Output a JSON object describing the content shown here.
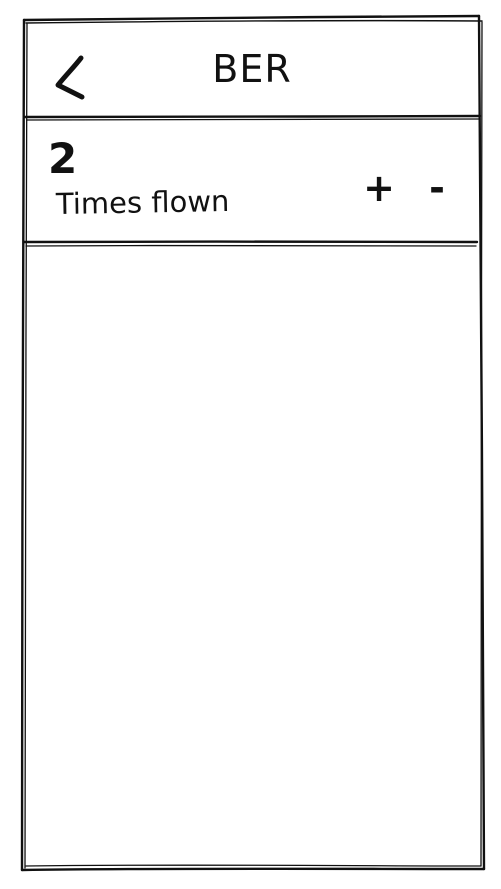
{
  "header": {
    "title": "BER",
    "back_icon": "chevron-left-icon"
  },
  "counter": {
    "value": "2",
    "label": "Times flown",
    "increment_label": "+",
    "decrement_label": "-"
  }
}
